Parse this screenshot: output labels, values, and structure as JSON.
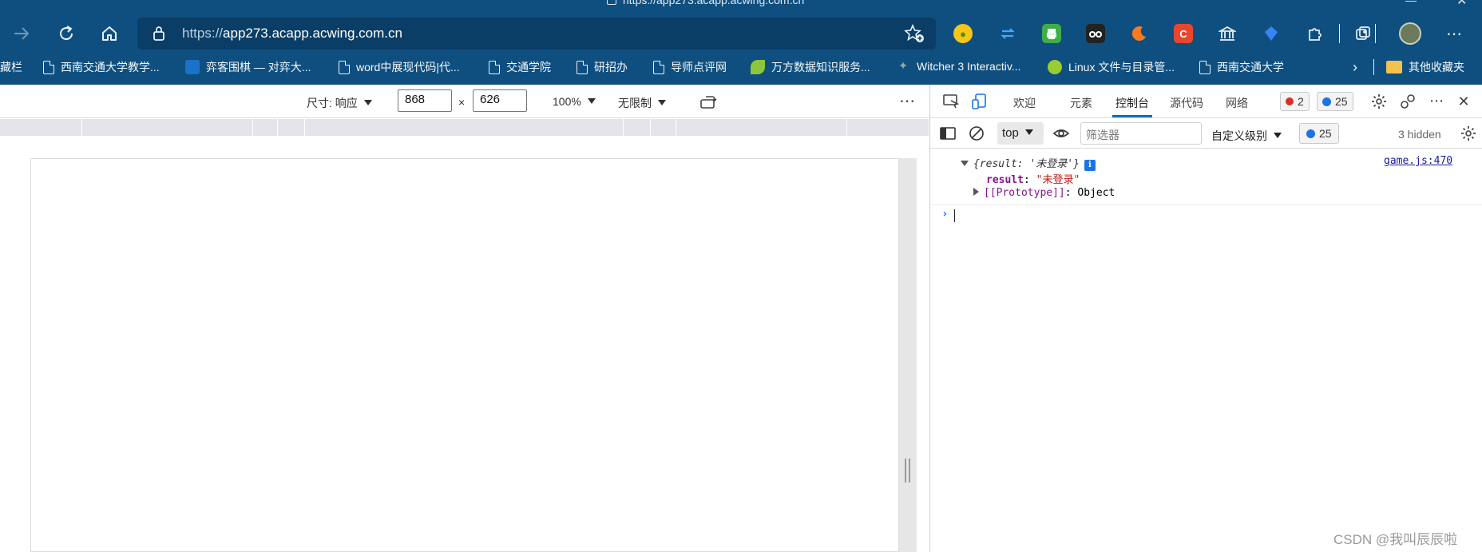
{
  "browser": {
    "title_sliver": "https://app273.acapp.acwing.com.cn",
    "address": {
      "scheme": "https://",
      "host": "app273.acapp.acwing.com.cn"
    },
    "extensions": [
      "extension-yellow",
      "sync-extension",
      "print-extension",
      "tampermonkey-extension",
      "dark-reader-extension",
      "c-extension",
      "library-extension",
      "blue-shield-extension"
    ],
    "menu_icon": "more-horizontal-icon"
  },
  "bookmarks": {
    "items": [
      {
        "label": "藏栏"
      },
      {
        "label": "西南交通大学教学..."
      },
      {
        "label": "弈客围棋 — 对弈大..."
      },
      {
        "label": "word中展现代码|代..."
      },
      {
        "label": "交通学院"
      },
      {
        "label": "研招办"
      },
      {
        "label": "导师点评网"
      },
      {
        "label": "万方数据知识服务..."
      },
      {
        "label": "Witcher 3 Interactiv..."
      },
      {
        "label": "Linux 文件与目录管..."
      },
      {
        "label": "西南交通大学"
      }
    ],
    "overflow_label": "其他收藏夹"
  },
  "device_toolbar": {
    "size_label": "尺寸: 响应",
    "width": "868",
    "times": "×",
    "height": "626",
    "zoom": "100%",
    "throttle": "无限制"
  },
  "devtools": {
    "tabs": [
      {
        "label": "欢迎"
      },
      {
        "label": "元素"
      },
      {
        "label": "控制台",
        "active": true
      },
      {
        "label": "源代码"
      },
      {
        "label": "网络"
      }
    ],
    "error_count": "2",
    "message_count": "25",
    "console": {
      "context": "top",
      "filter_placeholder": "筛选器",
      "level": "自定义级别",
      "message_badge": "25",
      "hidden": "3 hidden",
      "entries": {
        "preview": "{result: '未登录'}",
        "source": "game.js:470",
        "prop_key": "result",
        "prop_value": "\"未登录\"",
        "proto_key": "[[Prototype]]",
        "proto_value": "Object"
      }
    }
  },
  "watermark": "CSDN @我叫辰辰啦"
}
